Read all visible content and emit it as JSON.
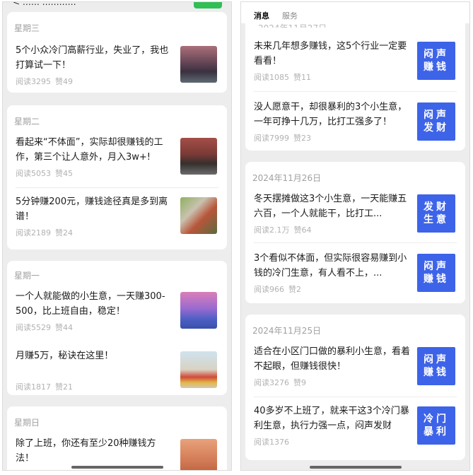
{
  "left": {
    "top_cut_text": "< ……  …………",
    "groups": [
      {
        "day": "星期三",
        "articles": [
          {
            "title": "5个小众冷门高薪行业，失业了，我也打算试一下！",
            "reads": "阅读3295",
            "likes": "赞49"
          }
        ]
      },
      {
        "day": "星期二",
        "articles": [
          {
            "title": "看起来“不体面”，实际却很赚钱的工作，第三个让人意外，月入3w+!",
            "reads": "阅读5053",
            "likes": "赞45"
          },
          {
            "title": "5分钟赚200元，赚钱途径真是多到离谱！",
            "reads": "阅读2189",
            "likes": "赞24"
          }
        ]
      },
      {
        "day": "星期一",
        "articles": [
          {
            "title": "一个人就能做的小生意，一天赚300-500，比上班自由，稳定！",
            "reads": "阅读5529",
            "likes": "赞44"
          },
          {
            "title": "月赚5万，秘诀在这里！",
            "reads": "阅读1817",
            "likes": "赞21"
          }
        ]
      },
      {
        "day": "星期日",
        "articles": [
          {
            "title": "除了上班，你还有至少20种赚钱方法！",
            "reads": "",
            "likes": ""
          }
        ]
      }
    ]
  },
  "right": {
    "tabs": [
      "消息",
      "服务"
    ],
    "top_date_cut": "2024年11月27日",
    "groups": [
      {
        "date": "",
        "articles": [
          {
            "title": "未来几年想多赚钱，这5个行业一定要看看！",
            "reads": "阅读1085",
            "likes": "赞11",
            "badge": [
              "闷声",
              "赚钱"
            ]
          },
          {
            "title": "没人愿意干，却很暴利的3个小生意，一年可挣十几万，比打工强多了！",
            "reads": "阅读7999",
            "likes": "赞23",
            "badge": [
              "闷声",
              "发财"
            ]
          }
        ]
      },
      {
        "date": "2024年11月26日",
        "articles": [
          {
            "title": "冬天摆摊做这3个小生意，一天能赚五六百，一个人就能干，比打工...",
            "reads": "阅读2.1万",
            "likes": "赞64",
            "badge": [
              "发财",
              "生意"
            ]
          },
          {
            "title": "3个看似不体面，但实际很容易赚到小钱的冷门生意，有人看不上，...",
            "reads": "阅读966",
            "likes": "赞2",
            "badge": [
              "闷声",
              "赚钱"
            ]
          }
        ]
      },
      {
        "date": "2024年11月25日",
        "articles": [
          {
            "title": "适合在小区门口做的暴利小生意，看着不起眼，但赚钱很快！",
            "reads": "阅读3276",
            "likes": "赞9",
            "badge": [
              "闷声",
              "赚钱"
            ]
          },
          {
            "title": "40多岁不上班了，就来干这3个冷门暴利生意，执行力强一点，闷声发财",
            "reads": "阅读1376",
            "likes": "",
            "badge": [
              "冷门",
              "暴利"
            ]
          }
        ]
      }
    ]
  }
}
